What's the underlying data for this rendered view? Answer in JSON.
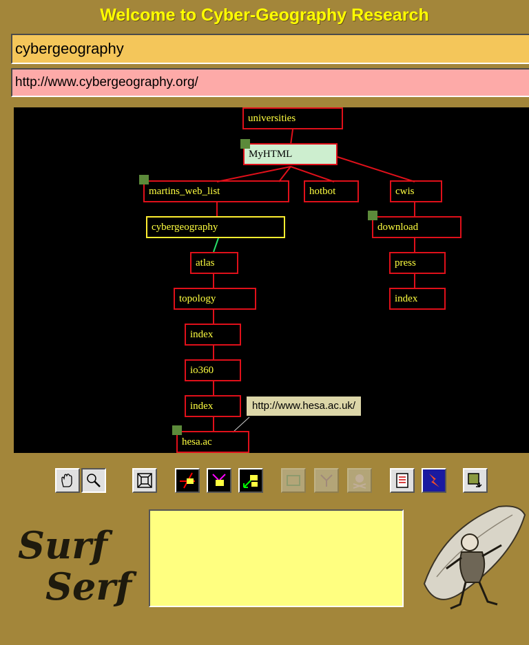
{
  "window": {
    "title": "Welcome to Cyber-Geography Research"
  },
  "query": {
    "value": "cybergeography"
  },
  "url": {
    "value": "http://www.cybergeography.org/"
  },
  "map": {
    "nodes": [
      {
        "label": "universities",
        "state": "normal"
      },
      {
        "label": "MyHTML",
        "state": "current"
      },
      {
        "label": "martins_web_list",
        "state": "normal"
      },
      {
        "label": "hotbot",
        "state": "normal"
      },
      {
        "label": "cwis",
        "state": "normal"
      },
      {
        "label": "cybergeography",
        "state": "selected"
      },
      {
        "label": "download",
        "state": "normal"
      },
      {
        "label": "atlas",
        "state": "normal"
      },
      {
        "label": "press",
        "state": "normal"
      },
      {
        "label": "topology",
        "state": "normal"
      },
      {
        "label": "index",
        "state": "normal"
      },
      {
        "label": "index",
        "state": "normal"
      },
      {
        "label": "io360",
        "state": "normal"
      },
      {
        "label": "index",
        "state": "normal"
      },
      {
        "label": "hesa.ac",
        "state": "normal"
      }
    ],
    "tooltip": "http://www.hesa.ac.uk/",
    "colors": {
      "node_border": "#e0101a",
      "node_text": "#ffff40",
      "selected_border": "#ffee30",
      "current_fill": "#cdeecf",
      "marker": "#5c8a3a"
    }
  },
  "toolbar": {
    "buttons": [
      {
        "icon": "hand-pan-icon",
        "enabled": true
      },
      {
        "icon": "magnifier-icon",
        "enabled": true
      },
      {
        "icon": "fit-window-icon",
        "enabled": true
      },
      {
        "icon": "layout-red-icon",
        "enabled": true
      },
      {
        "icon": "layout-magenta-icon",
        "enabled": true
      },
      {
        "icon": "layout-green-icon",
        "enabled": true
      },
      {
        "icon": "window-icon",
        "enabled": false
      },
      {
        "icon": "tree-icon",
        "enabled": false
      },
      {
        "icon": "skull-icon",
        "enabled": false
      },
      {
        "icon": "document-icon",
        "enabled": true
      },
      {
        "icon": "lightning-icon",
        "enabled": true
      },
      {
        "icon": "export-icon",
        "enabled": true
      }
    ]
  },
  "brand": {
    "line1": "Surf",
    "line2": "Serf"
  },
  "message": {
    "value": ""
  }
}
